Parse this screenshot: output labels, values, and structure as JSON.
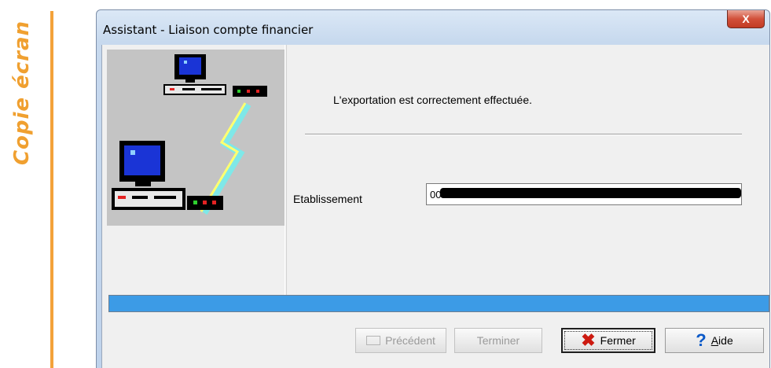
{
  "side": {
    "label": "Copie écran",
    "color": "#f0a030"
  },
  "window": {
    "title": "Assistant - Liaison compte financier",
    "close_label": "X"
  },
  "content": {
    "message": "L'exportation est correctement effectuée.",
    "field_label": "Etablissement",
    "field_value": "00",
    "progress_color": "#3c9be6"
  },
  "buttons": {
    "previous": "Précédent",
    "finish": "Terminer",
    "close": "Fermer",
    "help_underlined": "A",
    "help_rest": "ide"
  }
}
